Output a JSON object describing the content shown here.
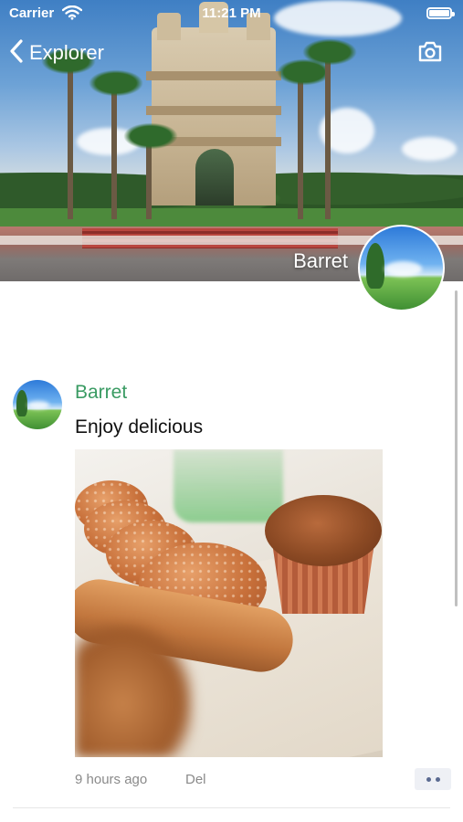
{
  "status_bar": {
    "carrier": "Carrier",
    "time": "11:21 PM"
  },
  "nav": {
    "back_label": "Explorer",
    "back_icon": "chevron-left-icon",
    "camera_icon": "camera-icon"
  },
  "profile": {
    "cover_name": "Barret"
  },
  "post": {
    "author": "Barret",
    "text": "Enjoy delicious",
    "time": "9 hours ago",
    "delete_label": "Del",
    "more_icon": "more-dots-icon"
  },
  "colors": {
    "author_name": "#3a9b63",
    "meta_text": "#8a8a8a",
    "more_button_bg": "#eef0f5",
    "more_button_dots": "#5a6a91"
  }
}
